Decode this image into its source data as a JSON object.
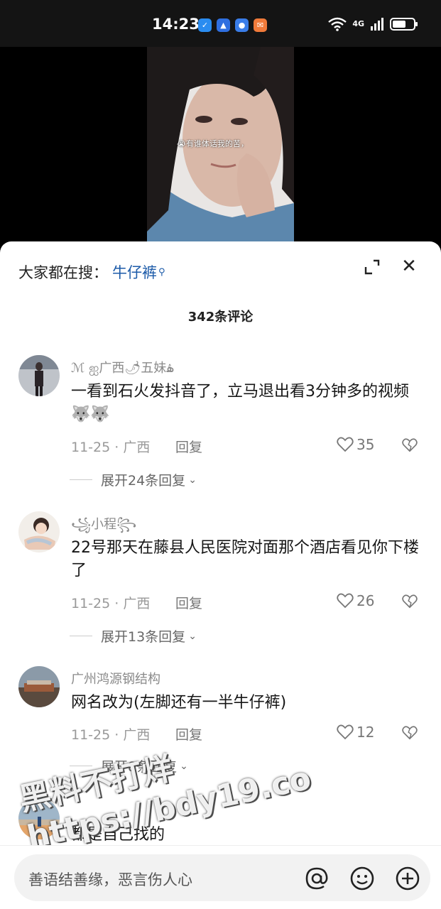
{
  "status_bar": {
    "time": "14:23",
    "network": "4G"
  },
  "video": {
    "caption": "😭有谁体话我的苦，"
  },
  "search_bar": {
    "prefix": "大家都在搜：",
    "term": "牛仔裤"
  },
  "comments_header": {
    "count_label": "342条评论"
  },
  "comments": [
    {
      "user": "ℳ ஐ广西🌶五妹ۿ",
      "text": "一看到石火发抖音了，立马退出看3分钟多的视频🐺🐺",
      "date": "11-25 · 广西",
      "reply": "回复",
      "likes": "35",
      "expand": "展开24条回复"
    },
    {
      "user": "꧁小程꧂",
      "text": "22号那天在藤县人民医院对面那个酒店看见你下楼了",
      "date": "11-25 · 广西",
      "reply": "回复",
      "likes": "26",
      "expand": "展开13条回复"
    },
    {
      "user": "广州鸿源钢结构",
      "text": "网名改为(左脚还有一半牛仔裤)",
      "date": "11-25 · 广西",
      "reply": "回复",
      "likes": "12",
      "expand": "展开8条回复"
    },
    {
      "user": "",
      "text": "都是自己找的",
      "date": "",
      "reply": "",
      "likes": "",
      "expand": ""
    }
  ],
  "watermark": {
    "line1": "黑料不打烊",
    "line2": "https://bdy19.co"
  },
  "input": {
    "placeholder": "善语结善缘，恶言伤人心"
  },
  "colors": {
    "accent": "#1b5aa8"
  },
  "icons": [
    "wifi-icon",
    "signal-icon",
    "battery-icon",
    "expand-icon",
    "close-icon",
    "heart-icon",
    "broken-heart-icon",
    "chevron-down-icon",
    "at-icon",
    "emoji-icon",
    "plus-circle-icon"
  ]
}
